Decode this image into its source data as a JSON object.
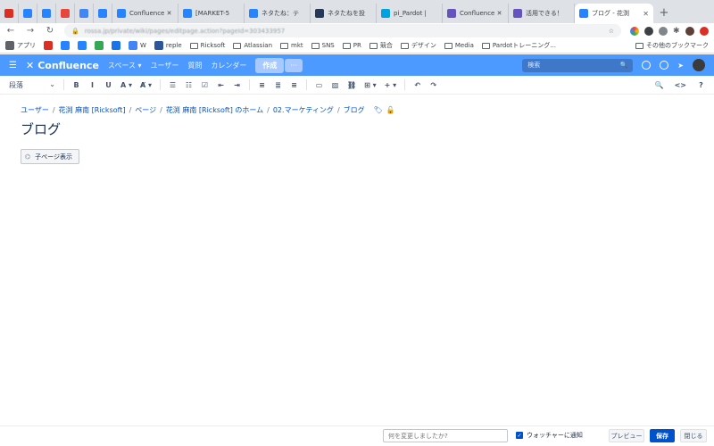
{
  "browser": {
    "tabs": [
      {
        "label": "",
        "icon": "gmail-icon",
        "color": "#d93025"
      },
      {
        "label": "",
        "icon": "confluence-icon",
        "color": "#2684ff"
      },
      {
        "label": "",
        "icon": "jira-icon",
        "color": "#2684ff"
      },
      {
        "label": "",
        "icon": "pdf-icon",
        "color": "#e8453c"
      },
      {
        "label": "",
        "icon": "calendar-icon",
        "color": "#4285f4"
      },
      {
        "label": "",
        "icon": "jira-icon",
        "color": "#2684ff"
      },
      {
        "label": "Confluence ✕",
        "icon": "confluence-icon",
        "color": "#2684ff"
      },
      {
        "label": "[MARKET-5",
        "icon": "jira-icon",
        "color": "#2684ff"
      },
      {
        "label": "ネタたね：テ",
        "icon": "confluence-icon",
        "color": "#2684ff"
      },
      {
        "label": "ネタたねを投",
        "icon": "jira-icon",
        "color": "#253858"
      },
      {
        "label": "pi_Pardot |",
        "icon": "salesforce-icon",
        "color": "#00a1e0"
      },
      {
        "label": "Confluence ✕",
        "icon": "app-icon",
        "color": "#6554c0"
      },
      {
        "label": "活用できる！",
        "icon": "app-icon",
        "color": "#6554c0"
      }
    ],
    "active_tab": "ブログ - 花渕",
    "url": "rossa.jp/private/wiki/pages/editpage.action?pageId=303433957",
    "bookmarks": [
      "アプリ",
      "",
      "",
      "",
      "",
      "",
      "W",
      "reple",
      "Ricksoft",
      "Atlassian",
      "mkt",
      "SNS",
      "PR",
      "競合",
      "デザイン",
      "Media",
      "Pardotトレーニング..."
    ],
    "other_bookmarks": "その他のブックマーク"
  },
  "confluence": {
    "logo": "Confluence",
    "menu": [
      "スペース ▾",
      "ユーザー",
      "質問",
      "カレンダー"
    ],
    "create": "作成",
    "more": "···",
    "search_placeholder": "検索"
  },
  "toolbar": {
    "paragraph": "段落",
    "format": [
      "B",
      "I",
      "U",
      "A ▾",
      "A̸ ▾"
    ],
    "lists": [
      "☰",
      "☷",
      "☑",
      "⇤",
      "⇥"
    ],
    "align": [
      "≡",
      "≣",
      "≡"
    ],
    "insert": [
      "▭",
      "▨",
      "⛓",
      "⊞ ▾",
      "+ ▾"
    ],
    "history": [
      "↶",
      "↷"
    ],
    "right": [
      "🔍",
      "<>",
      "?"
    ]
  },
  "breadcrumb": [
    "ユーザー",
    "花渕 麻南 [Ricksoft]",
    "ページ",
    "花渕 麻南 [Ricksoft] のホーム",
    "02.マーケティング",
    "ブログ"
  ],
  "page": {
    "title": "ブログ",
    "child_pages_button": "子ページ表示"
  },
  "footer": {
    "change_placeholder": "何を変更しましたか?",
    "watch_label": "ウォッチャーに通知",
    "preview": "プレビュー",
    "save": "保存",
    "close": "閉じる"
  }
}
